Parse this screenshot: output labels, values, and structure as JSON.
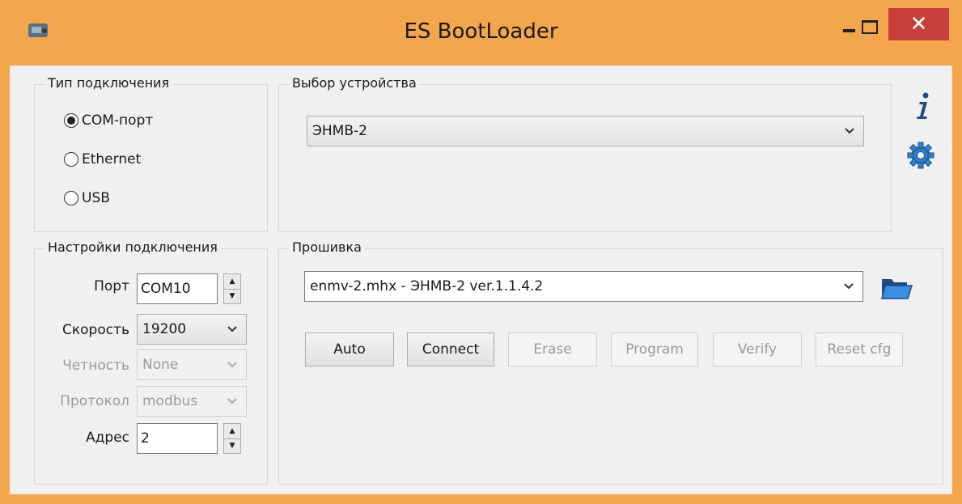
{
  "window": {
    "title": "ES BootLoader",
    "close_glyph": "✕"
  },
  "connection_type": {
    "label": "Тип подключения",
    "options": [
      {
        "label": "COM-порт",
        "checked": true
      },
      {
        "label": "Ethernet",
        "checked": false
      },
      {
        "label": "USB",
        "checked": false
      }
    ]
  },
  "device_select": {
    "label": "Выбор устройства",
    "value": "ЭНМВ-2"
  },
  "connection_settings": {
    "label": "Настройки подключения",
    "port": {
      "label": "Порт",
      "value": "COM10"
    },
    "speed": {
      "label": "Скорость",
      "value": "19200"
    },
    "parity": {
      "label": "Четность",
      "value": "None",
      "disabled": true
    },
    "protocol": {
      "label": "Протокол",
      "value": "modbus",
      "disabled": true
    },
    "address": {
      "label": "Адрес",
      "value": "2"
    }
  },
  "firmware": {
    "label": "Прошивка",
    "file_value": "enmv-2.mhx  - ЭНМВ-2 ver.1.1.4.2",
    "buttons": [
      {
        "label": "Auto",
        "enabled": true
      },
      {
        "label": "Connect",
        "enabled": true
      },
      {
        "label": "Erase",
        "enabled": false
      },
      {
        "label": "Program",
        "enabled": false
      },
      {
        "label": "Verify",
        "enabled": false
      },
      {
        "label": "Reset cfg",
        "enabled": false
      }
    ]
  },
  "icons": {
    "info": "info-icon",
    "settings": "gear-icon",
    "open_folder": "folder-open-icon",
    "app": "app-icon"
  },
  "colors": {
    "titlebar": "#f4a64c",
    "close": "#c7413a",
    "icon_blue": "#2f7fd0"
  }
}
